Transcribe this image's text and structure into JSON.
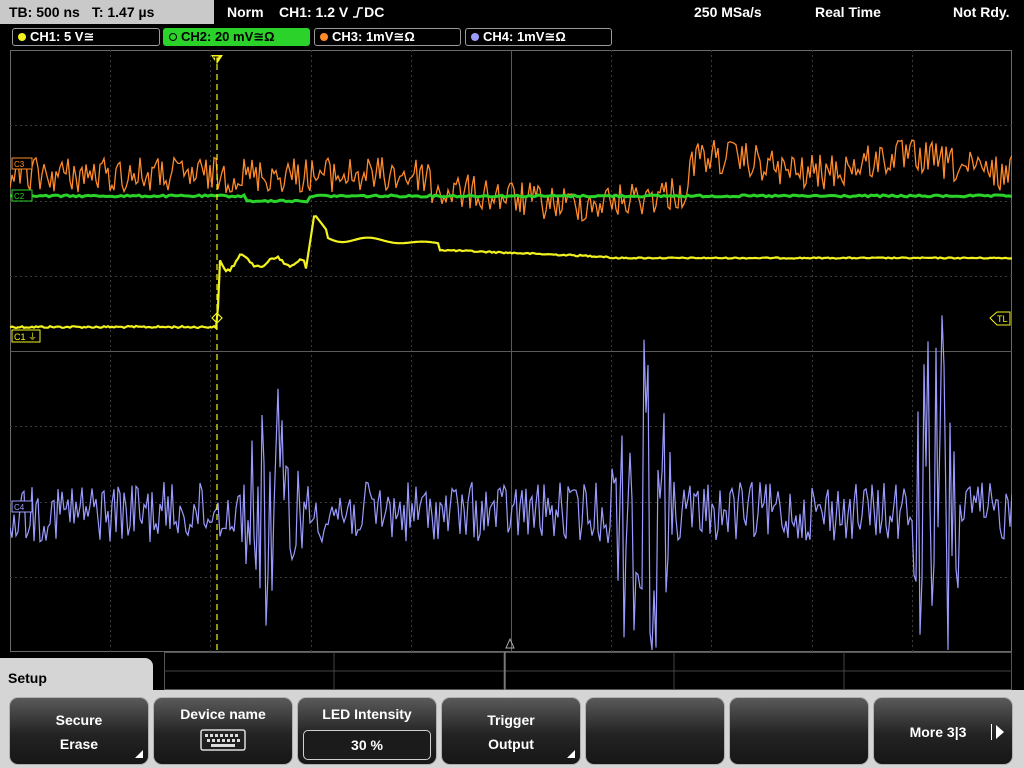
{
  "topbar": {
    "timebase": "TB: 500 ns",
    "trigger_time": "T: 1.47 µs",
    "mode": "Norm",
    "trigger_info": "CH1: 1.2 V",
    "trigger_coupling": "DC",
    "sample_rate": "250 MSa/s",
    "acq_mode": "Real Time",
    "status": "Not Rdy."
  },
  "channels": [
    {
      "label": "CH1: 5 V",
      "suffix": "≅",
      "color": "#f2f21e",
      "active": false
    },
    {
      "label": "CH2: 20 mV",
      "suffix": "≅Ω",
      "color": "#2ad22a",
      "active": true
    },
    {
      "label": "CH3: 1mV",
      "suffix": "≅Ω",
      "color": "#ff8a2a",
      "active": false
    },
    {
      "label": "CH4: 1mV",
      "suffix": "≅Ω",
      "color": "#9b9bff",
      "active": false
    }
  ],
  "markers": {
    "ch1": "C1",
    "ch2": "C2",
    "ch3": "C3",
    "ch4": "C4",
    "trigger_level": "TL",
    "trigger_pos": "T"
  },
  "setup": {
    "title": "Setup",
    "softkeys": [
      {
        "line1": "Secure",
        "line2": "Erase"
      },
      {
        "line1": "Device name",
        "icon": "keyboard-icon"
      },
      {
        "line1": "LED Intensity",
        "value": "30 %"
      },
      {
        "line1": "Trigger",
        "line2": "Output"
      },
      {
        "line1": ""
      },
      {
        "line1": ""
      },
      {
        "line1": "More 3|3"
      }
    ]
  },
  "colors": {
    "ch1": "#f2f21e",
    "ch2": "#2ad22a",
    "ch3": "#ff8a2a",
    "ch4": "#9b9bff",
    "grid": "#3a3a3a",
    "trigger_line": "#f2f21e"
  }
}
